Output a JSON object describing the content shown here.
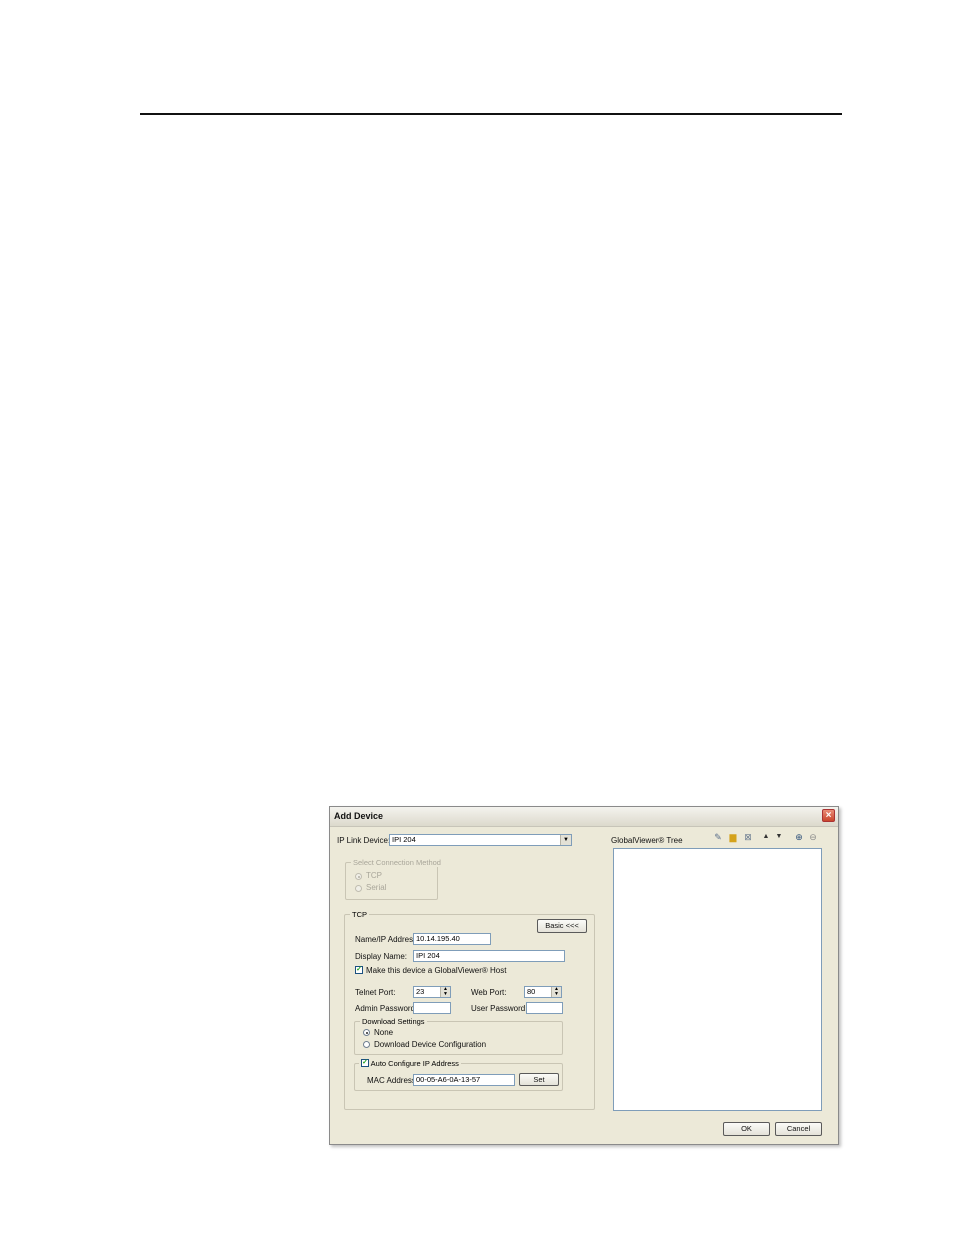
{
  "dialog": {
    "title": "Add Device",
    "ip_link_device_label": "IP Link Device:",
    "ip_link_device_value": "IPI 204",
    "select_connection_method": {
      "label": "Select Connection Method",
      "options": [
        "TCP",
        "Serial"
      ],
      "selected": "TCP"
    },
    "tcp_group": {
      "label": "TCP",
      "basic_button": "Basic <<<",
      "name_ip_label": "Name/IP Address:",
      "name_ip_value": "10.14.195.40",
      "display_name_label": "Display Name:",
      "display_name_value": "IPI 204",
      "globalviewer_host_label": "Make this device a GlobalViewer® Host",
      "globalviewer_host_checked": true,
      "telnet_port_label": "Telnet Port:",
      "telnet_port_value": "23",
      "web_port_label": "Web Port:",
      "web_port_value": "80",
      "admin_password_label": "Admin Password:",
      "admin_password_value": "",
      "user_password_label": "User Password:",
      "user_password_value": ""
    },
    "download_settings": {
      "label": "Download Settings",
      "options": [
        "None",
        "Download Device Configuration"
      ],
      "selected": "None"
    },
    "auto_configure": {
      "label": "Auto Configure IP Address",
      "checked": true,
      "mac_label": "MAC Address:",
      "mac_value": "00-05-A6-0A-13-57",
      "set_button": "Set"
    },
    "tree": {
      "label": "GlobalViewer® Tree",
      "toolbar_icons": [
        "pencil-icon",
        "folder-icon",
        "delete-icon",
        "move-up-icon",
        "move-down-icon",
        "expand-icon",
        "collapse-icon"
      ]
    },
    "ok_button": "OK",
    "cancel_button": "Cancel"
  }
}
